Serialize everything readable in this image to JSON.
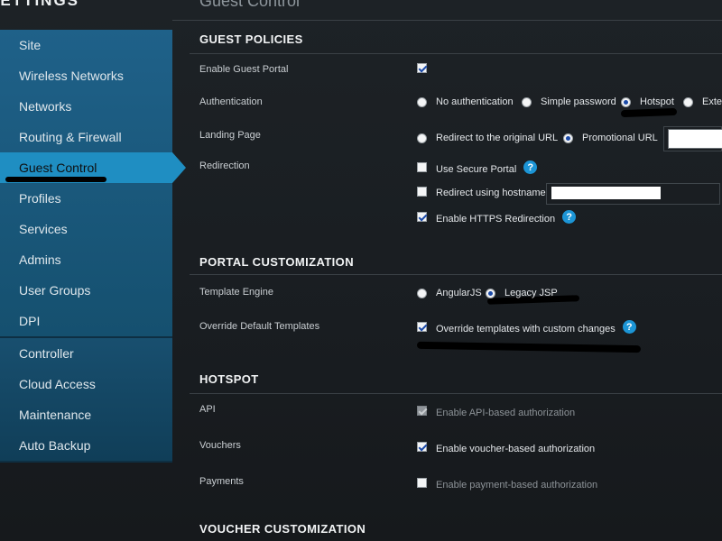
{
  "app": {
    "title": "SETTINGS"
  },
  "sidebar": {
    "group1": [
      {
        "label": "Site"
      },
      {
        "label": "Wireless Networks"
      },
      {
        "label": "Networks"
      },
      {
        "label": "Routing & Firewall"
      },
      {
        "label": "Guest Control",
        "active": true
      },
      {
        "label": "Profiles"
      },
      {
        "label": "Services"
      },
      {
        "label": "Admins"
      },
      {
        "label": "User Groups"
      },
      {
        "label": "DPI"
      }
    ],
    "group2": [
      {
        "label": "Controller"
      },
      {
        "label": "Cloud Access"
      },
      {
        "label": "Maintenance"
      },
      {
        "label": "Auto Backup"
      }
    ]
  },
  "page": {
    "title": "Guest Control"
  },
  "guest_policies": {
    "title": "GUEST POLICIES",
    "enable_portal": {
      "label": "Enable Guest Portal",
      "checked": true
    },
    "authentication": {
      "label": "Authentication",
      "options": [
        "No authentication",
        "Simple password",
        "Hotspot",
        "External portal server"
      ],
      "selected": "Hotspot"
    },
    "landing_page": {
      "label": "Landing Page",
      "options": [
        "Redirect to the original URL",
        "Promotional URL"
      ],
      "selected": "Promotional URL",
      "url_value": ""
    },
    "redirection": {
      "label": "Redirection",
      "secure_portal": {
        "label": "Use Secure Portal",
        "checked": false
      },
      "redirect_hostname": {
        "label": "Redirect using hostname",
        "checked": false,
        "value": ""
      },
      "https_redirection": {
        "label": "Enable HTTPS Redirection",
        "checked": true
      }
    }
  },
  "portal_customization": {
    "title": "PORTAL CUSTOMIZATION",
    "template_engine": {
      "label": "Template Engine",
      "options": [
        "AngularJS",
        "Legacy JSP"
      ],
      "selected": "Legacy JSP"
    },
    "override_templates": {
      "label": "Override Default Templates",
      "option_label": "Override templates with custom changes",
      "checked": true
    }
  },
  "hotspot": {
    "title": "HOTSPOT",
    "api": {
      "label": "API",
      "option_label": "Enable API-based authorization",
      "checked": true,
      "disabled": true
    },
    "vouchers": {
      "label": "Vouchers",
      "option_label": "Enable voucher-based authorization",
      "checked": true
    },
    "payments": {
      "label": "Payments",
      "option_label": "Enable payment-based authorization",
      "checked": false
    }
  },
  "voucher_customization": {
    "title": "VOUCHER CUSTOMIZATION"
  },
  "help_glyph": "?",
  "colors": {
    "accent": "#1f8ec2",
    "help": "#1c95d6",
    "sidebar": "#1f6189"
  }
}
